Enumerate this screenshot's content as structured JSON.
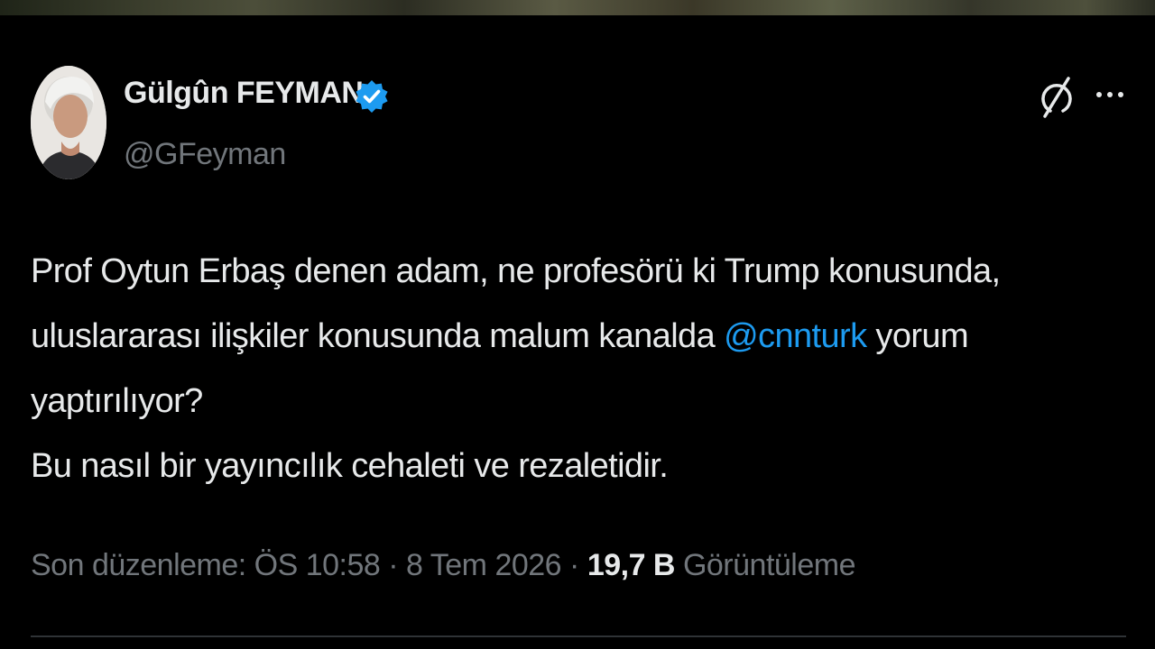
{
  "author": {
    "display_name": "Gülgûn FEYMAN",
    "handle": "@GFeyman",
    "verified": true
  },
  "tweet": {
    "line1": "Prof Oytun Erbaş denen adam, ne profesörü ki Trump konusunda,",
    "line2_before": "uluslararası ilişkiler konusunda malum kanalda ",
    "line2_mention": "@cnnturk",
    "line2_after": " yorum",
    "line3": "yaptırılıyor?",
    "line4": "Bu nasıl bir yayıncılık cehaleti ve rezaletidir."
  },
  "meta": {
    "edited_label": "Son düzenleme: ÖS 10:58 · 8 Tem 2026 · ",
    "views_count": "19,7 B",
    "views_label": " Görüntüleme"
  },
  "icons": {
    "grok": "grok-icon",
    "more": "more-icon",
    "verified": "verified-badge-icon"
  },
  "colors": {
    "background": "#000000",
    "text": "#e7e9ea",
    "secondary": "#71767b",
    "accent": "#1d9bf0"
  }
}
